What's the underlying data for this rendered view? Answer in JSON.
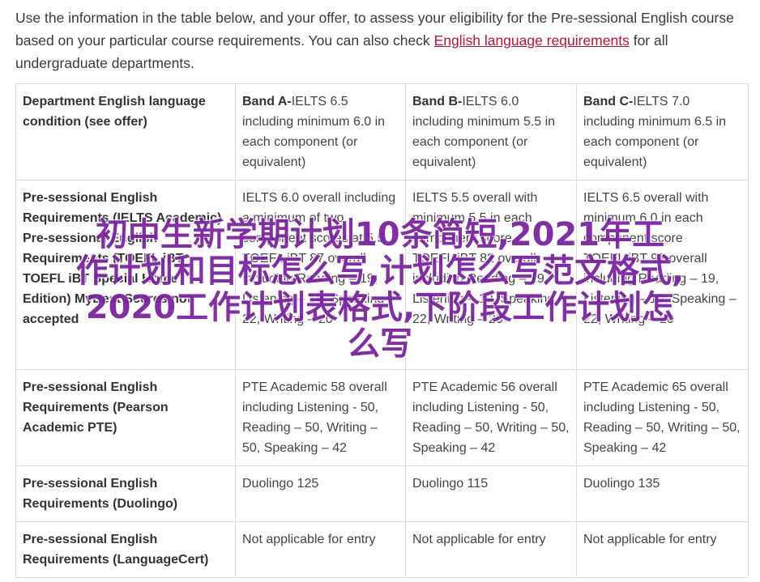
{
  "intro": {
    "text_before": "Use the information in the table below, and your offer, to assess your eligibility for the Pre-sessional English course based on your particular course requirements. You can also check ",
    "link": "English language requirements",
    "text_after": " for all undergraduate departments."
  },
  "table": {
    "rows": [
      {
        "label": "Department English language condition (see offer)",
        "cells": [
          {
            "bold": "Band A-",
            "text": "IELTS 6.5 including minimum 6.0 in each component (or equivalent)"
          },
          {
            "bold": "Band B-",
            "text": "IELTS 6.0 including minimum 5.5 in each component (or equivalent)"
          },
          {
            "bold": "Band C-",
            "text": "IELTS 7.0 including minimum 6.5 in each component (or equivalent)"
          }
        ]
      },
      {
        "label": "Pre-sessional English Requirements (IELTS Academic)\nPre-sessional English Requirements (TOEFL iBT, TOEFL iBT Special Home Edition) MyBest Scores not accepted",
        "cells": [
          {
            "bold": "",
            "text": "IELTS 6.0 overall including a minimum of two component scores at 5.5\nTOEFL iBT 87 overall including Reading – 19, Listening – 19, Speaking – 22, Writing – 20"
          },
          {
            "bold": "",
            "text": "IELTS 5.5 overall with minimum 5.5 in each component score\nTOEFL iBT 82 overall including Reading – 19, Listening – 19, Speaking – 22, Writing – 20"
          },
          {
            "bold": "",
            "text": "IELTS 6.5 overall with minimum 6.0 in each component score\nTOEFL iBT 92 overall including Reading – 19, Listening – 19, Speaking – 22, Writing – 20"
          }
        ]
      },
      {
        "label": "Pre-sessional English Requirements (Pearson Academic PTE)",
        "cells": [
          {
            "bold": "",
            "text": "PTE Academic 58 overall including Listening - 50, Reading – 50, Writing – 50, Speaking – 42"
          },
          {
            "bold": "",
            "text": "PTE Academic 56 overall including Listening - 50, Reading – 50, Writing – 50, Speaking – 42"
          },
          {
            "bold": "",
            "text": "PTE Academic 65 overall including Listening - 50, Reading – 50, Writing – 50, Speaking – 42"
          }
        ]
      },
      {
        "label": "Pre-sessional English Requirements (Duolingo)",
        "cells": [
          {
            "bold": "",
            "text": "Duolingo 125"
          },
          {
            "bold": "",
            "text": "Duolingo 115"
          },
          {
            "bold": "",
            "text": "Duolingo 135"
          }
        ]
      },
      {
        "label": "Pre-sessional English Requirements (LanguageCert)",
        "cells": [
          {
            "bold": "",
            "text": "Not applicable for entry"
          },
          {
            "bold": "",
            "text": "Not applicable for entry"
          },
          {
            "bold": "",
            "text": "Not applicable for entry"
          }
        ]
      }
    ]
  },
  "overlay": {
    "lines": [
      "初中生新学期计划10条简短,2021年工",
      "作计划和目标怎么写,计划怎么写范文格式,",
      "2020工作计划表格式,下阶段工作计划怎",
      "么写"
    ]
  },
  "colors": {
    "link": "#c8102e",
    "overlay_text": "#7a1fa2",
    "border": "#dcdcdc"
  }
}
